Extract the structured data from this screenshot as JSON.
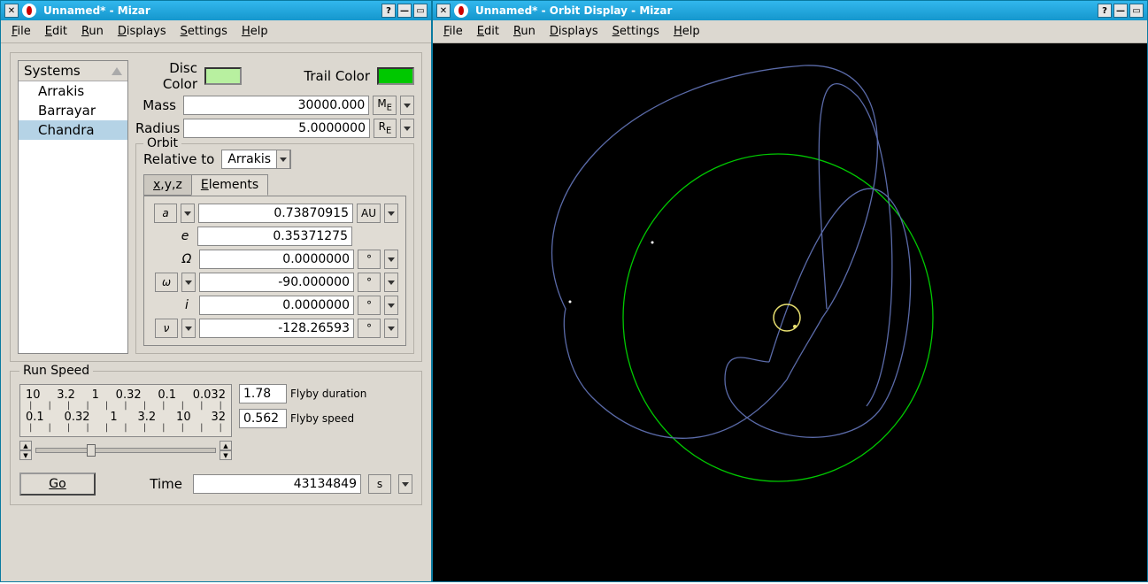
{
  "left_window": {
    "title": "Unnamed* - Mizar",
    "menubar": [
      "File",
      "Edit",
      "Run",
      "Displays",
      "Settings",
      "Help"
    ],
    "systems": {
      "header": "Systems",
      "items": [
        "Arrakis",
        "Barrayar",
        "Chandra"
      ],
      "selected_index": 2
    },
    "colors": {
      "disc_label": "Disc Color",
      "disc_value": "#b8f0a0",
      "trail_label": "Trail Color",
      "trail_value": "#00c800"
    },
    "mass": {
      "label": "Mass",
      "value": "30000.000",
      "unit": "M",
      "unit_sub": "E"
    },
    "radius": {
      "label": "Radius",
      "value": "5.0000000",
      "unit": "R",
      "unit_sub": "E"
    },
    "orbit": {
      "legend": "Orbit",
      "relative_label": "Relative to",
      "relative_value": "Arrakis",
      "tabs": [
        "x,y,z",
        "Elements"
      ],
      "active_tab": 1,
      "elements": [
        {
          "sym": "a",
          "value": "0.73870915",
          "unit": "AU",
          "has_dd": true
        },
        {
          "sym": "e",
          "value": "0.35371275",
          "unit": "",
          "has_dd": false
        },
        {
          "sym": "Ω",
          "value": "0.0000000",
          "unit": "°",
          "has_dd": false,
          "unit_dd": true
        },
        {
          "sym": "ω",
          "value": "-90.000000",
          "unit": "°",
          "has_dd": true,
          "unit_dd": true
        },
        {
          "sym": "i",
          "value": "0.0000000",
          "unit": "°",
          "has_dd": false,
          "unit_dd": true
        },
        {
          "sym": "ν",
          "value": "-128.26593",
          "unit": "°",
          "has_dd": true,
          "unit_dd": true
        }
      ]
    },
    "run_speed": {
      "legend": "Run Speed",
      "scale_top": [
        "10",
        "3.2",
        "1",
        "0.32",
        "0.1",
        "0.032"
      ],
      "scale_bottom": [
        "0.1",
        "0.32",
        "1",
        "3.2",
        "10",
        "32"
      ],
      "flyby_duration_label": "Flyby duration",
      "flyby_duration_value": "1.78",
      "flyby_speed_label": "Flyby speed",
      "flyby_speed_value": "0.562"
    },
    "go_label": "Go",
    "time_label": "Time",
    "time_value": "43134849",
    "time_unit": "s"
  },
  "right_window": {
    "title": "Unnamed* - Orbit Display - Mizar",
    "menubar": [
      "File",
      "Edit",
      "Run",
      "Displays",
      "Settings",
      "Help"
    ]
  }
}
